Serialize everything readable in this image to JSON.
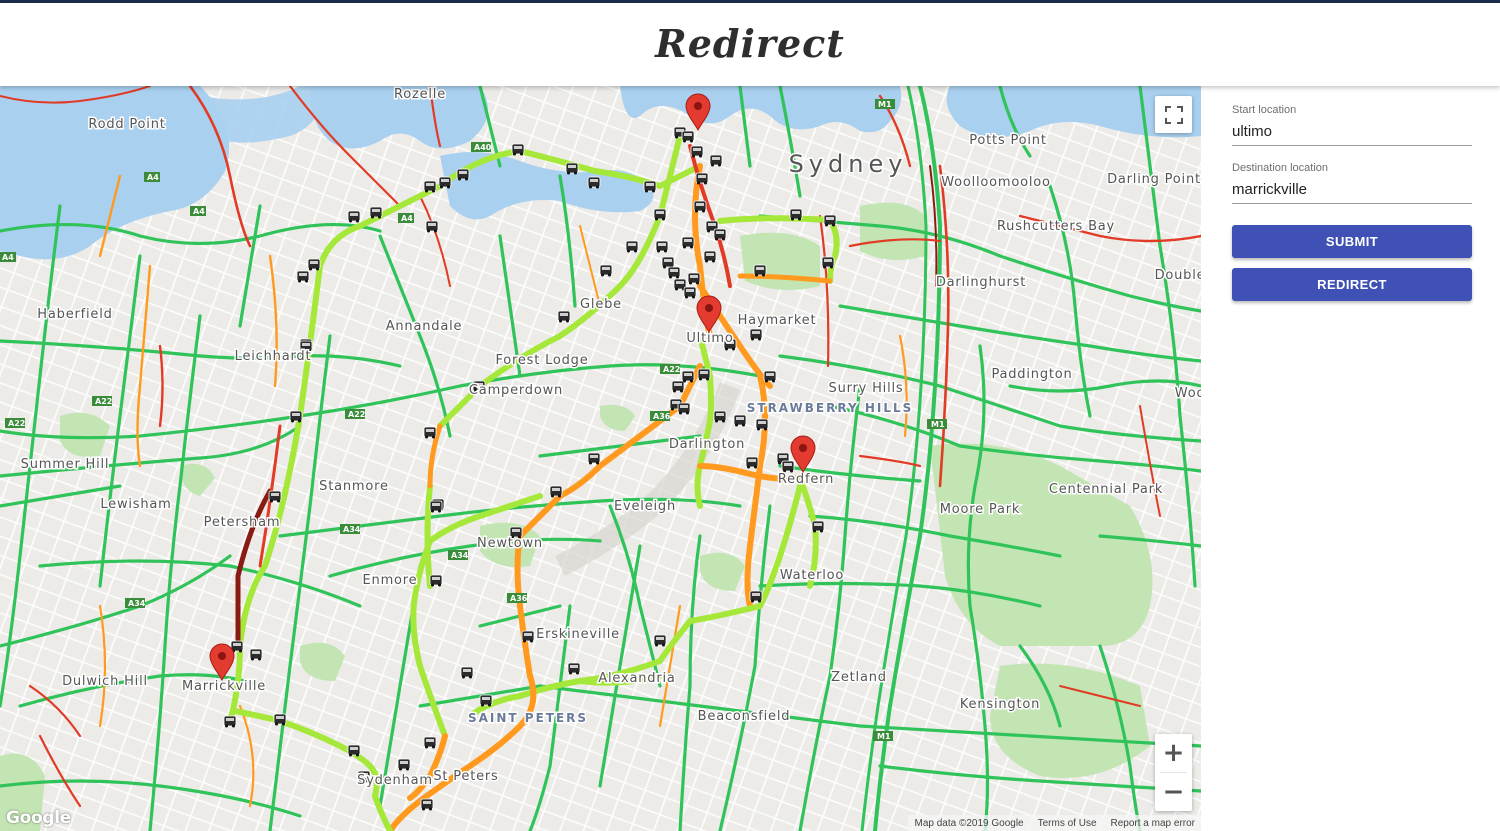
{
  "app": {
    "title": "Redirect"
  },
  "form": {
    "start_label": "Start location",
    "start_value": "ultimo",
    "dest_label": "Destination location",
    "dest_value": "marrickville",
    "submit_label": "SUBMIT",
    "redirect_label": "REDIRECT"
  },
  "map": {
    "attribution": [
      "Map data ©2019 Google",
      "Terms of Use",
      "Report a map error"
    ],
    "logo": "Google",
    "zoom_in": "+",
    "zoom_out": "−",
    "fullscreen_icon": "fullscreen-icon",
    "place_labels": [
      "Rozelle",
      "Rodd Point",
      "Haberfield",
      "Leichhardt",
      "Annandale",
      "Glebe",
      "Forest Lodge",
      "Camperdown",
      "Summer Hill",
      "Lewisham",
      "Petersham",
      "Stanmore",
      "Enmore",
      "Newtown",
      "Dulwich Hill",
      "Marrickville",
      "Sydenham",
      "St Peters",
      "SAINT PETERS",
      "Erskineville",
      "Alexandria",
      "Beaconsfield",
      "Zetland",
      "Kensington",
      "Eveleigh",
      "Darlington",
      "Ultimo",
      "Haymarket",
      "Sydney",
      "Surry Hills",
      "STRAWBERRY HILLS",
      "Redfern",
      "Waterloo",
      "Moore Park",
      "Centennial Park",
      "Paddington",
      "Darlinghurst",
      "Woolloomooloo",
      "Potts Point",
      "Rushcutters Bay",
      "Darling Point",
      "Double",
      "Woo"
    ],
    "road_labels": [
      "A4",
      "A40",
      "A22",
      "A36",
      "A34",
      "M1"
    ],
    "colors": {
      "water": "#a9d0ef",
      "park": "#c3e5b4",
      "road_fast": "#30c35a",
      "road_mid": "#ff9a1f",
      "road_slow": "#e23b25",
      "road_jam": "#8a1b12",
      "route": "#a6e83a",
      "marker": "#e33b2f",
      "button": "#3f51b5"
    }
  }
}
